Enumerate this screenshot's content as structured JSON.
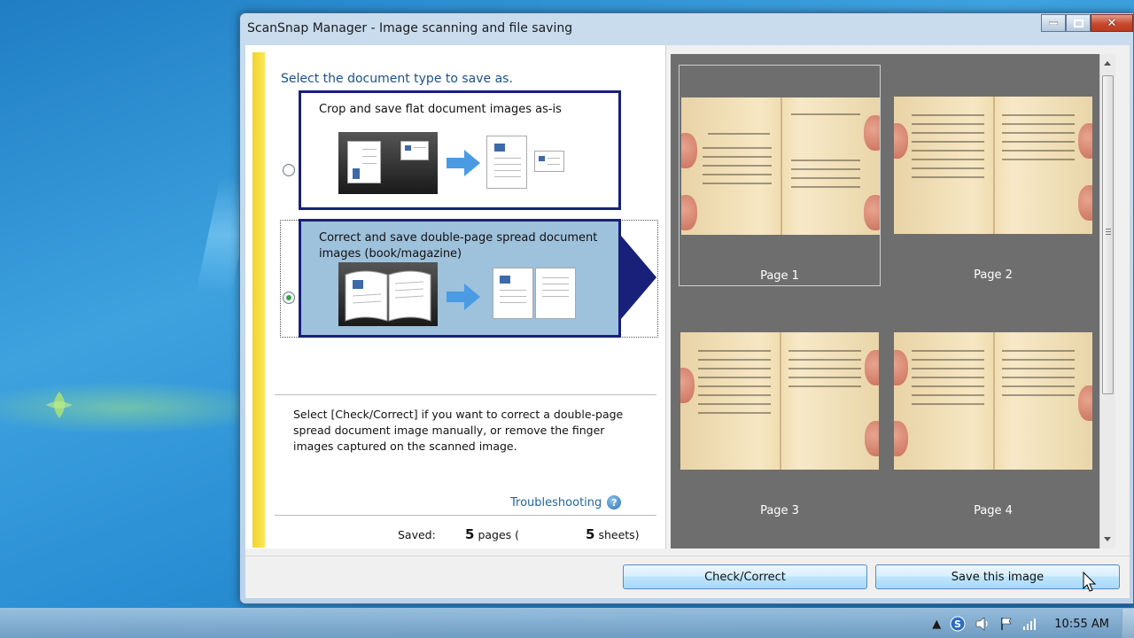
{
  "window": {
    "title": "ScanSnap Manager - Image scanning and file saving"
  },
  "left_panel": {
    "heading": "Select the document type to save as.",
    "options": [
      {
        "label": "Crop and save flat document images as-is",
        "selected": false
      },
      {
        "label": "Correct and save double-page spread document images (book/magazine)",
        "selected": true
      }
    ],
    "description": "Select [Check/Correct] if you want to correct a double-page spread document image manually, or remove the finger images captured on the scanned image.",
    "troubleshooting": "Troubleshooting",
    "saved": {
      "label": "Saved:",
      "pages_count": "5",
      "pages_text": "pages (",
      "sheets_count": "5",
      "sheets_text": "sheets)"
    }
  },
  "preview": {
    "pages": [
      {
        "label": "Page 1",
        "selected": true
      },
      {
        "label": "Page 2",
        "selected": false
      },
      {
        "label": "Page 3",
        "selected": false
      },
      {
        "label": "Page 4",
        "selected": false
      }
    ]
  },
  "buttons": {
    "check_correct": "Check/Correct",
    "save_image": "Save this image"
  },
  "taskbar": {
    "clock": "10:55 AM"
  },
  "icons": [
    "scansnap-tray-icon",
    "volume-icon",
    "flag-icon",
    "network-icon",
    "help-icon",
    "close-icon",
    "maximize-icon",
    "minimize-icon"
  ]
}
